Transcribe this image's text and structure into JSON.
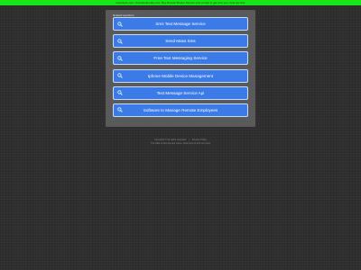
{
  "banner": {
    "text": "texasbyte.com / domainsforsale.com: Buy Domain Broker Service now to help to get it for you. Find out how",
    "color": "#19e619"
  },
  "panel": {
    "title": "Related searches",
    "items": [
      {
        "label": "Sms Text Message Service",
        "icon": "search-icon"
      },
      {
        "label": "Send Mass Sms",
        "icon": "search-icon"
      },
      {
        "label": "Free Text Messaging Service",
        "icon": "search-icon"
      },
      {
        "label": "Iphone Mobile Device Management",
        "icon": "search-icon"
      },
      {
        "label": "Text Message Service Api",
        "icon": "search-icon"
      },
      {
        "label": "Software to Manage Remote Employees",
        "icon": "search-icon"
      }
    ],
    "button_color": "#3b7be8"
  },
  "footer": {
    "copyright": "Copyright © All rights reserved.",
    "privacy": "Privacy Policy",
    "notice": "The Sale of this domain name. Click here to find out more"
  }
}
